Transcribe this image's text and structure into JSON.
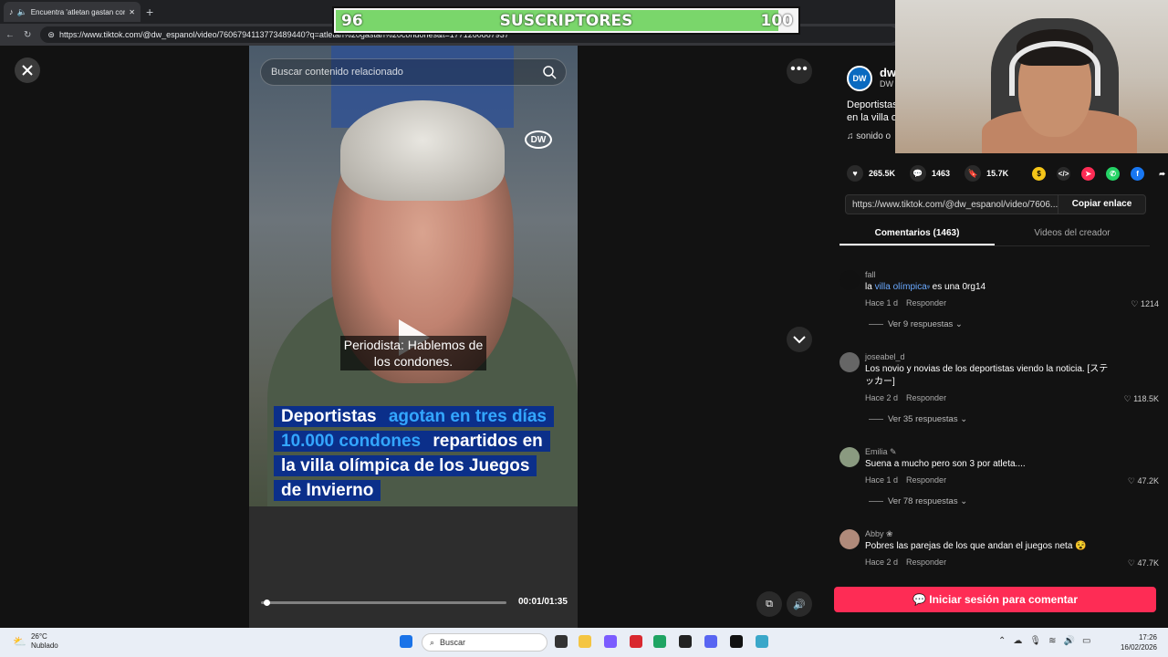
{
  "browser": {
    "tab_title": "Encuentra 'atletan gastan con...",
    "url": "https://www.tiktok.com/@dw_espanol/video/7606794113773489440?q=atletan%20gastan%20condones&t=1771260867937"
  },
  "overlay": {
    "sub_left": "96",
    "sub_center": "SUSCRIPTORES",
    "sub_right": "100",
    "sub_progress": 0.96
  },
  "video": {
    "search_placeholder": "Buscar contenido relacionado",
    "logo": "DW",
    "subtitle": "Periodista: Hablemos de los condones.",
    "headline_part1": "Deportistas ",
    "headline_highlight": "agotan en tres días 10.000 condones",
    "headline_part2": " repartidos en la villa olímpica de los Juegos de Invierno",
    "time": "00:01/01:35",
    "progress": 0.01
  },
  "author": {
    "name": "dw",
    "handle": "DW",
    "desc_line1": "Deportistas",
    "desc_line2": "en la villa o",
    "sound": "sonido o"
  },
  "stats": {
    "likes": "265.5K",
    "comments": "1463",
    "saves": "15.7K"
  },
  "link": {
    "url": "https://www.tiktok.com/@dw_espanol/video/7606...",
    "copy_label": "Copiar enlace"
  },
  "tabs": {
    "comments": "Comentarios (1463)",
    "creator_videos": "Videos del creador"
  },
  "comments": [
    {
      "user": "fall",
      "text_pre": "la ",
      "text_link": "villa olímpica",
      "text_post": " es una 0rg14",
      "time": "Hace 1 d",
      "reply": "Responder",
      "likes": "1214",
      "replies": "Ver 9 respuestas"
    },
    {
      "user": "joseabel_d",
      "text": "Los novio y novias de los deportistas viendo la noticia. [ステッカー]",
      "time": "Hace 2 d",
      "reply": "Responder",
      "likes": "118.5K",
      "replies": "Ver 35 respuestas"
    },
    {
      "user": "Emilia",
      "text": "Suena a mucho pero son 3 por atleta....",
      "time": "Hace 1 d",
      "reply": "Responder",
      "likes": "47.2K",
      "replies": "Ver 78 respuestas"
    },
    {
      "user": "Abby",
      "text": "Pobres las parejas de los que andan el juegos neta",
      "time": "Hace 2 d",
      "reply": "Responder",
      "likes": "47.7K"
    }
  ],
  "login_button": "Iniciar sesión para comentar",
  "taskbar": {
    "temp": "26°C",
    "weather": "Nublado",
    "search": "Buscar",
    "time": "17:26",
    "date": "16/02/2026"
  }
}
